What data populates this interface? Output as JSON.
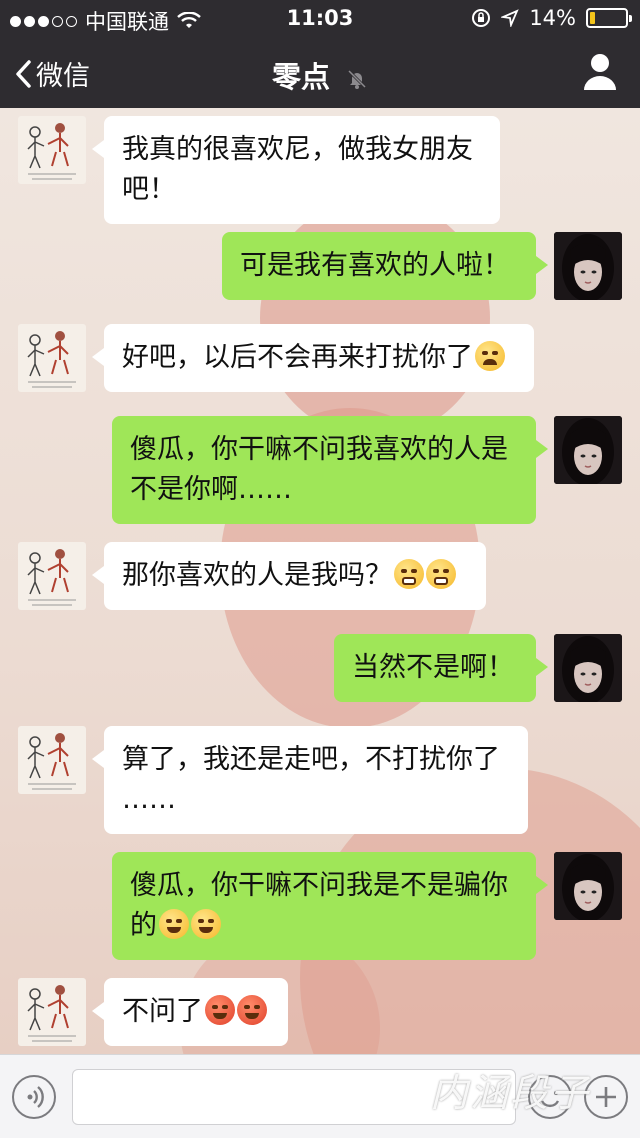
{
  "status_bar": {
    "carrier": "中国联通",
    "time": "11:03",
    "battery_text": "14%",
    "battery_level": 0.14,
    "battery_color": "#f3c41b"
  },
  "nav": {
    "back_label": "微信",
    "title": "零点"
  },
  "messages": [
    {
      "side": "in",
      "lines": [
        "我真的很喜欢尼，做我女朋友",
        "吧！"
      ],
      "emojis": []
    },
    {
      "side": "out",
      "lines": [
        "可是我有喜欢的人啦！"
      ],
      "emojis": []
    },
    {
      "side": "in",
      "lines": [
        "好吧，以后不会再来打扰你了"
      ],
      "emojis": [
        "tired-face"
      ]
    },
    {
      "side": "out",
      "lines": [
        "傻瓜，你干嘛不问我喜欢的人是",
        "不是你啊……"
      ],
      "emojis": []
    },
    {
      "side": "in",
      "lines": [
        "那你喜欢的人是我吗？"
      ],
      "emojis": [
        "grimacing-face",
        "grimacing-face"
      ]
    },
    {
      "side": "out",
      "lines": [
        "当然不是啊！"
      ],
      "emojis": []
    },
    {
      "side": "in",
      "lines": [
        "算了，我还是走吧，不打扰你了",
        "……"
      ],
      "emojis": []
    },
    {
      "side": "out",
      "lines": [
        "傻瓜，你干嘛不问我是不是骗你",
        "的"
      ],
      "emojis": [
        "triumph-face",
        "triumph-face"
      ]
    },
    {
      "side": "in",
      "lines": [
        "不问了"
      ],
      "emojis": [
        "angry-face",
        "angry-face"
      ]
    }
  ],
  "colors": {
    "header_bg": "#2e2c30",
    "outgoing_bubble": "#9fe658",
    "incoming_bubble": "#ffffff"
  },
  "input": {
    "value": ""
  },
  "watermark": "内涵段子"
}
